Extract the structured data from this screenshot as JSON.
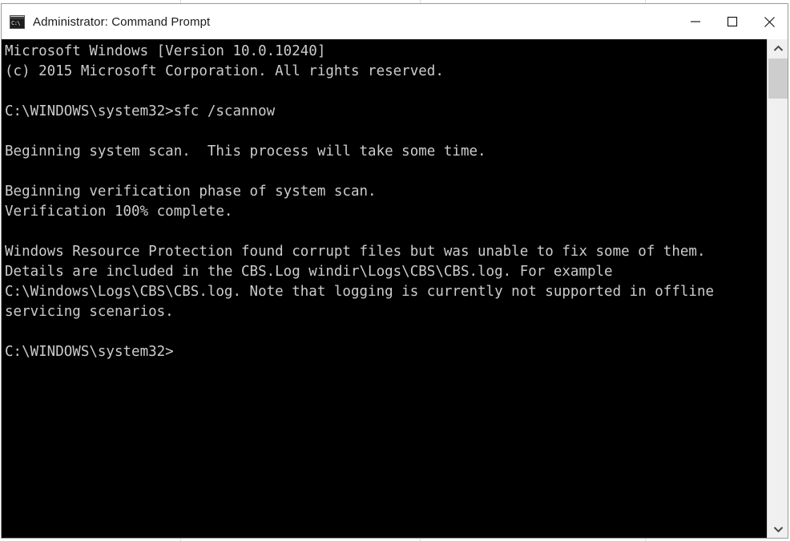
{
  "window": {
    "title": "Administrator: Command Prompt",
    "icon": "command-prompt-icon",
    "controls": {
      "minimize": "Minimize",
      "maximize": "Maximize",
      "close": "Close"
    }
  },
  "console": {
    "background_color": "#000000",
    "text_color": "#cccccc",
    "content": "Microsoft Windows [Version 10.0.10240]\n(c) 2015 Microsoft Corporation. All rights reserved.\n\nC:\\WINDOWS\\system32>sfc /scannow\n\nBeginning system scan.  This process will take some time.\n\nBeginning verification phase of system scan.\nVerification 100% complete.\n\nWindows Resource Protection found corrupt files but was unable to fix some of them. Details are included in the CBS.Log windir\\Logs\\CBS\\CBS.log. For example C:\\Windows\\Logs\\CBS\\CBS.log. Note that logging is currently not supported in offline servicing scenarios.\n\nC:\\WINDOWS\\system32>",
    "lines": [
      "Microsoft Windows [Version 10.0.10240]",
      "(c) 2015 Microsoft Corporation. All rights reserved.",
      "",
      "C:\\WINDOWS\\system32>sfc /scannow",
      "",
      "Beginning system scan.  This process will take some time.",
      "",
      "Beginning verification phase of system scan.",
      "Verification 100% complete.",
      "",
      "Windows Resource Protection found corrupt files but was unable to fix some of them. Details are included in the CBS.Log windir\\Logs\\CBS\\CBS.log. For example C:\\Windows\\Logs\\CBS\\CBS.log. Note that logging is currently not supported in offline servicing scenarios.",
      "",
      "C:\\WINDOWS\\system32>"
    ],
    "command_entered": "sfc /scannow",
    "prompt": "C:\\WINDOWS\\system32>",
    "os_version": "10.0.10240",
    "copyright_year": "2015",
    "verification_percent": "100%"
  },
  "scrollbar": {
    "up_arrow": "chevron-up-icon",
    "down_arrow": "chevron-down-icon",
    "thumb": "scrollbar-thumb"
  }
}
